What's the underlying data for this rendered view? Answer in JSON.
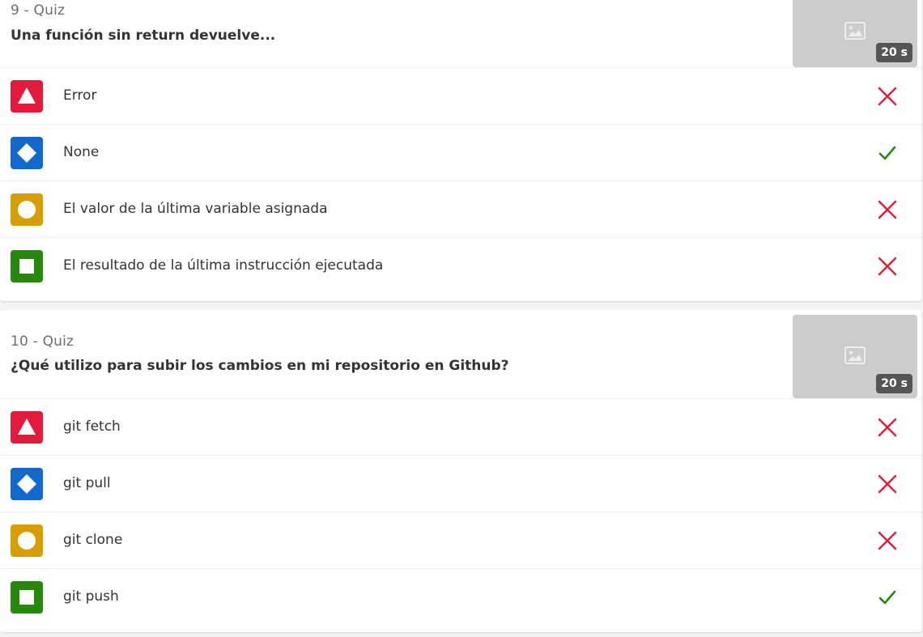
{
  "colors": {
    "red": "#e21b3c",
    "blue": "#1368ce",
    "yellow": "#d89e00",
    "green": "#26890c",
    "correct": "#26890c",
    "incorrect": "#e21b3c"
  },
  "questions": [
    {
      "number_label": "9 - Quiz",
      "text": "Una función sin return devuelve...",
      "image_icon": "image-placeholder-icon",
      "time_label": "20 s",
      "answers": [
        {
          "shape": "triangle-icon",
          "color": "red",
          "text": "Error",
          "result": "incorrect"
        },
        {
          "shape": "diamond-icon",
          "color": "blue",
          "text": "None",
          "result": "correct"
        },
        {
          "shape": "circle-icon",
          "color": "yellow",
          "text": "El valor de la última variable asignada",
          "result": "incorrect"
        },
        {
          "shape": "square-icon",
          "color": "green",
          "text": "El resultado de la última instrucción ejecutada",
          "result": "incorrect"
        }
      ]
    },
    {
      "number_label": "10 - Quiz",
      "text": "¿Qué utilizo para subir los cambios en mi repositorio en Github?",
      "image_icon": "image-placeholder-icon",
      "time_label": "20 s",
      "answers": [
        {
          "shape": "triangle-icon",
          "color": "red",
          "text": "git fetch",
          "result": "incorrect"
        },
        {
          "shape": "diamond-icon",
          "color": "blue",
          "text": "git pull",
          "result": "incorrect"
        },
        {
          "shape": "circle-icon",
          "color": "yellow",
          "text": "git clone",
          "result": "incorrect"
        },
        {
          "shape": "square-icon",
          "color": "green",
          "text": "git push",
          "result": "correct"
        }
      ]
    }
  ]
}
